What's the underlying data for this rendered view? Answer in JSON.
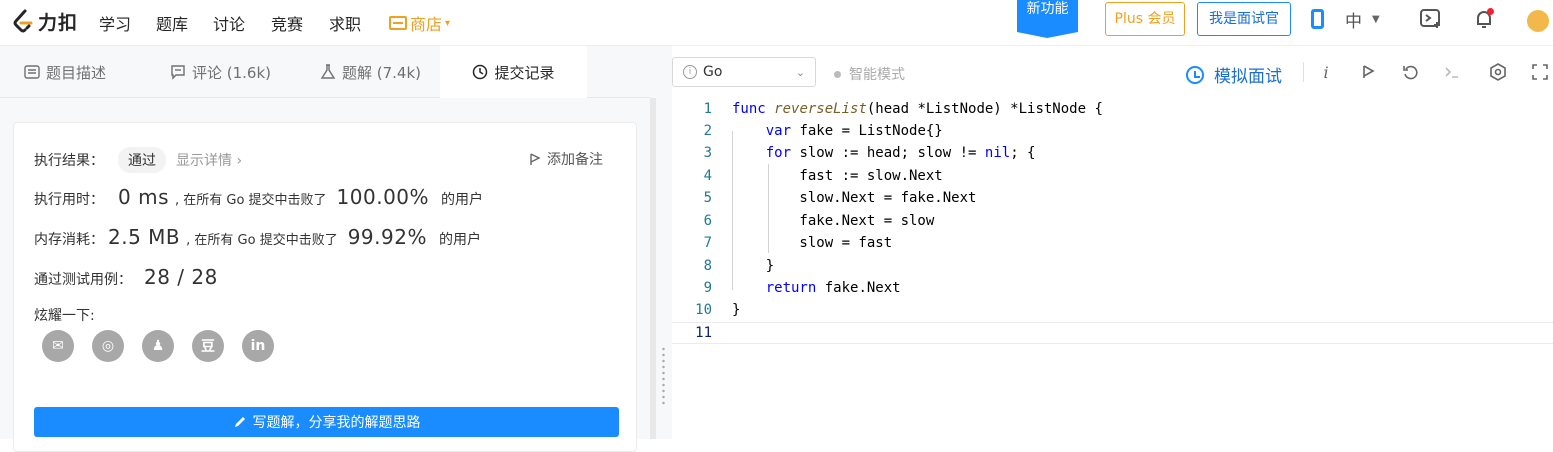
{
  "topnav": {
    "brand": "力扣",
    "links": [
      "学习",
      "题库",
      "讨论",
      "竞赛",
      "求职"
    ],
    "shop": "商店",
    "new_feature": "新功能",
    "plus": "Plus 会员",
    "interviewer": "我是面试官",
    "lang": "中"
  },
  "tabs": [
    {
      "label": "题目描述",
      "icon": "description-icon"
    },
    {
      "label": "评论 (1.6k)",
      "icon": "comment-icon"
    },
    {
      "label": "题解 (7.4k)",
      "icon": "flask-icon"
    },
    {
      "label": "提交记录",
      "icon": "clock-icon"
    }
  ],
  "result": {
    "exec_label": "执行结果：",
    "status": "通过",
    "detail": "显示详情 ›",
    "note": "添加备注",
    "time_label": "执行用时：",
    "time_value": "0 ms",
    "time_text": ", 在所有 Go 提交中击败了",
    "time_pct": "100.00%",
    "time_suffix": "的用户",
    "mem_label": "内存消耗：",
    "mem_value": "2.5 MB",
    "mem_text": ", 在所有 Go 提交中击败了",
    "mem_pct": "99.92%",
    "mem_suffix": "的用户",
    "cases_label": "通过测试用例：",
    "cases_value": "28 / 28",
    "share_label": "炫耀一下:",
    "share_icons": [
      "wechat-icon",
      "weibo-icon",
      "qq-icon",
      "douban-icon",
      "linkedin-icon"
    ],
    "share_glyphs": [
      "✉",
      "◎",
      "♟",
      "豆",
      "in"
    ],
    "write_btn": "写题解，分享我的解题思路"
  },
  "editor": {
    "language": "Go",
    "smart_mode": "智能模式",
    "mock_interview": "模拟面试",
    "line_numbers": [
      "1",
      "2",
      "3",
      "4",
      "5",
      "6",
      "7",
      "8",
      "9",
      "10",
      "11"
    ]
  },
  "colors": {
    "accent": "#1a8cff",
    "shop": "#f0a020",
    "keyword": "#0000ff",
    "line_number": "#237893"
  }
}
